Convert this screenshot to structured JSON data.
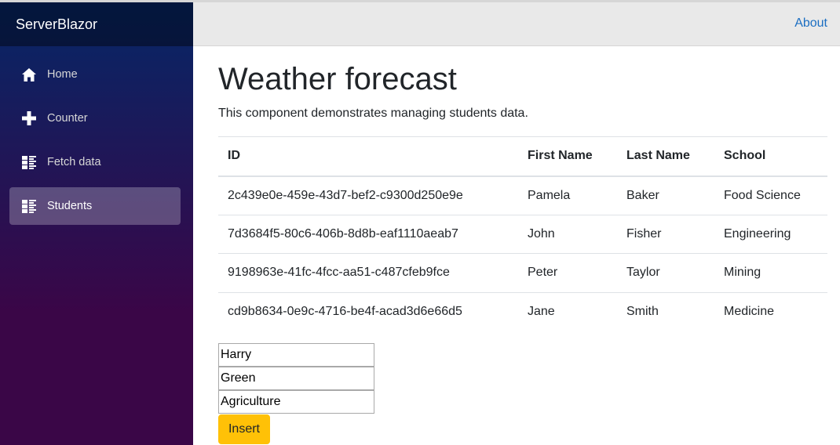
{
  "brand": "ServerBlazor",
  "nav": {
    "items": [
      {
        "label": "Home",
        "icon": "home-icon"
      },
      {
        "label": "Counter",
        "icon": "plus-icon"
      },
      {
        "label": "Fetch data",
        "icon": "list-rich-icon"
      },
      {
        "label": "Students",
        "icon": "list-rich-icon",
        "active": true
      }
    ]
  },
  "top": {
    "about": "About"
  },
  "page": {
    "title": "Weather forecast",
    "description": "This component demonstrates managing students data."
  },
  "table": {
    "headers": [
      "ID",
      "First Name",
      "Last Name",
      "School"
    ],
    "rows": [
      [
        "2c439e0e-459e-43d7-bef2-c9300d250e9e",
        "Pamela",
        "Baker",
        "Food Science"
      ],
      [
        "7d3684f5-80c6-406b-8d8b-eaf1110aeab7",
        "John",
        "Fisher",
        "Engineering"
      ],
      [
        "9198963e-41fc-4fcc-aa51-c487cfeb9fce",
        "Peter",
        "Taylor",
        "Mining"
      ],
      [
        "cd9b8634-0e9c-4716-be4f-acad3d6e66d5",
        "Jane",
        "Smith",
        "Medicine"
      ]
    ]
  },
  "form": {
    "first_name_value": "Harry",
    "last_name_value": "Green",
    "school_value": "Agriculture",
    "insert_label": "Insert"
  },
  "colors": {
    "accent": "#ffc107",
    "link": "#1b6ec2",
    "sidebar_top": "#052767",
    "sidebar_bottom": "#3a0647"
  }
}
